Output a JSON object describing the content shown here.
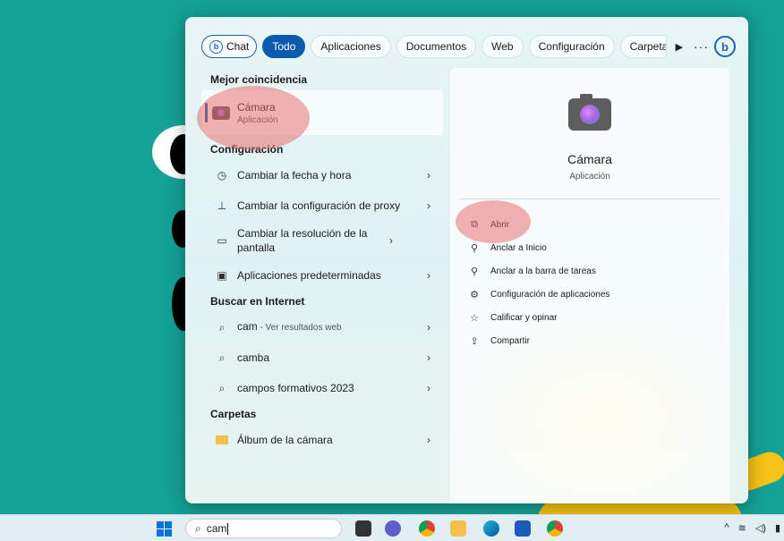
{
  "tabs": {
    "chat": "Chat",
    "todo": "Todo",
    "aplicaciones": "Aplicaciones",
    "documentos": "Documentos",
    "web": "Web",
    "configuracion": "Configuración",
    "carpeta": "Carpeta",
    "more": "···"
  },
  "sections": {
    "best_match": "Mejor coincidencia",
    "settings": "Configuración",
    "internet": "Buscar en Internet",
    "folders": "Carpetas"
  },
  "best_match": {
    "name": "Cámara",
    "type": "Aplicación"
  },
  "settings_items": [
    {
      "label": "Cambiar la fecha y hora"
    },
    {
      "label": "Cambiar la configuración de proxy"
    },
    {
      "label": "Cambiar la resolución de la pantalla"
    },
    {
      "label": "Aplicaciones predeterminadas"
    }
  ],
  "internet_items": [
    {
      "label": "cam",
      "suffix": " - Ver resultados web"
    },
    {
      "label": "camba"
    },
    {
      "label": "campos formativos 2023"
    }
  ],
  "folder_items": [
    {
      "label": "Álbum de la cámara"
    }
  ],
  "detail": {
    "name": "Cámara",
    "type": "Aplicación",
    "actions": [
      "Abrir",
      "Anclar a Inicio",
      "Anclar a la barra de tareas",
      "Configuración de aplicaciones",
      "Calificar y opinar",
      "Compartir"
    ]
  },
  "taskbar": {
    "search_value": "cam"
  },
  "icons": {
    "bing": "b",
    "chevron": "›",
    "play": "▶"
  }
}
